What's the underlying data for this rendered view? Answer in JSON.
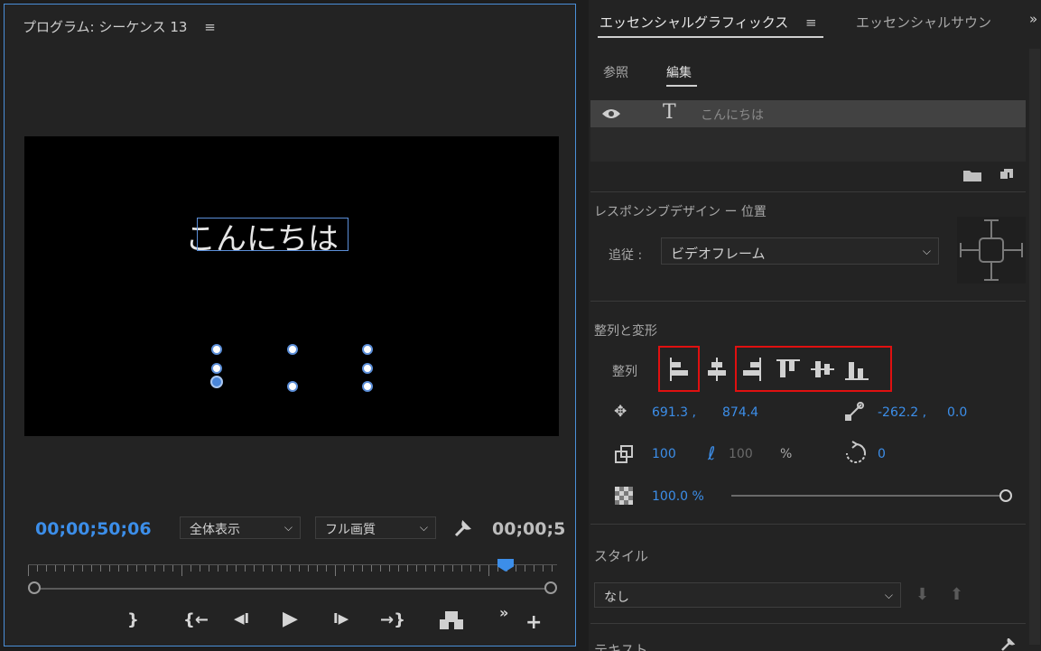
{
  "program_monitor": {
    "title": "プログラム: シーケンス 13",
    "menu_icon": "≡",
    "overlay_text": "こんにちは",
    "timecode_current": "00;00;50;06",
    "zoom_select": "全体表示",
    "quality_select": "フル画質",
    "timecode_duration": "00;00;5",
    "controls": {
      "mark_out": "}",
      "go_to_in": "{←",
      "step_back": "◀I",
      "play": "▶",
      "step_forward": "I▶",
      "go_to_out": "→}",
      "export_frame": "⎘",
      "more": "»",
      "add": "+"
    }
  },
  "essential_graphics": {
    "tab_title": "エッセンシャルグラフィックス",
    "tab_menu_icon": "≡",
    "tab2_title": "エッセンシャルサウン",
    "overflow": "»",
    "subtabs": [
      "参照",
      "編集"
    ],
    "active_subtab": "編集",
    "layer_name": "こんにちは",
    "responsive_title": "レスポンシブデザイン ー 位置",
    "follow_label": "追従 :",
    "follow_value": "ビデオフレーム",
    "align_transform_title": "整列と変形",
    "align_label": "整列",
    "position_x": "691.3",
    "position_y": "874.4",
    "anchor_x": "-262.2",
    "anchor_y": "0.0",
    "scale": "100",
    "scale_linked": "100",
    "percent": "%",
    "rotation": "0",
    "opacity": "100.0 %",
    "opacity_fraction": 1.0,
    "style_title": "スタイル",
    "style_value": "なし",
    "text_section": "テキスト",
    "accent_color": "#3c8ee9",
    "highlight_color": "#e01010"
  }
}
